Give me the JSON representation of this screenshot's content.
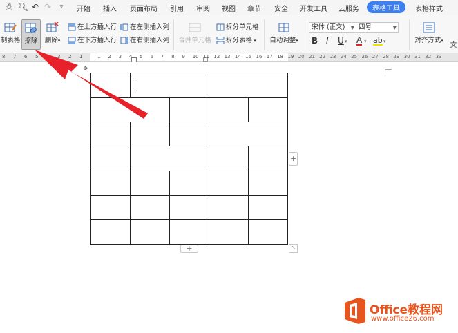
{
  "menubar": {
    "tabs": [
      "开始",
      "插入",
      "页面布局",
      "引用",
      "审阅",
      "视图",
      "章节",
      "安全",
      "开发工具",
      "云服务",
      "表格工具",
      "表格样式"
    ],
    "active_tab": "表格工具"
  },
  "ribbon": {
    "draw_table": "制表格",
    "eraser": "擦除",
    "delete": "删除",
    "insert_above": "在上方插入行",
    "insert_below": "在下方插入行",
    "insert_left": "在左侧插入列",
    "insert_right": "在右侧插入列",
    "merge_cells": "合并单元格",
    "split_cells": "拆分单元格",
    "split_table": "拆分表格",
    "auto_fit": "自动调整",
    "font_name": "宋体 (正文)",
    "font_size": "四号",
    "bold": "B",
    "italic": "I",
    "underline": "U",
    "font_color": "A",
    "highlight": "ab",
    "align": "对齐方式",
    "text_dir": "文"
  },
  "ruler": {
    "left_numbers": [
      "8",
      "7",
      "6",
      "5",
      "4",
      "3",
      "2",
      "1"
    ],
    "right_numbers": [
      "1",
      "2",
      "3",
      "4",
      "5",
      "6",
      "7",
      "8",
      "9",
      "10",
      "11",
      "12",
      "13",
      "14",
      "15",
      "16",
      "17",
      "18",
      "19",
      "20",
      "21",
      "22",
      "23",
      "24",
      "25",
      "26",
      "27",
      "28",
      "29",
      "30",
      "31",
      "32",
      "33"
    ]
  },
  "table": {
    "rows": 7,
    "add_row": "+",
    "add_col": "+"
  },
  "watermark": {
    "brand": "Office教程网",
    "url": "www.office26.com"
  },
  "colors": {
    "accent": "#3b7ff0",
    "arrow": "#e8222a",
    "logo": "#e8541d"
  }
}
